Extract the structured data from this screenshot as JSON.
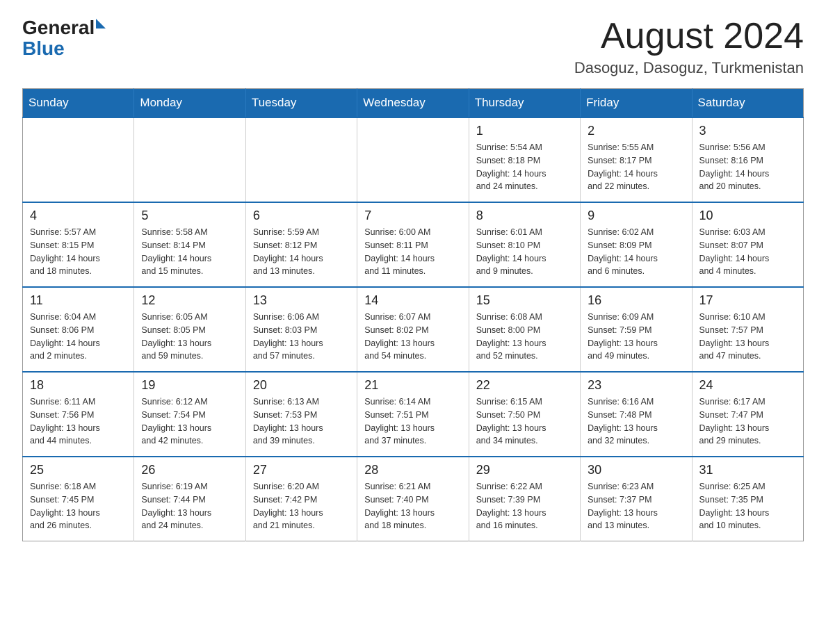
{
  "logo": {
    "general": "General",
    "triangle": "",
    "blue": "Blue"
  },
  "title": {
    "month": "August 2024",
    "location": "Dasoguz, Dasoguz, Turkmenistan"
  },
  "weekdays": [
    "Sunday",
    "Monday",
    "Tuesday",
    "Wednesday",
    "Thursday",
    "Friday",
    "Saturday"
  ],
  "weeks": [
    [
      {
        "day": "",
        "info": ""
      },
      {
        "day": "",
        "info": ""
      },
      {
        "day": "",
        "info": ""
      },
      {
        "day": "",
        "info": ""
      },
      {
        "day": "1",
        "info": "Sunrise: 5:54 AM\nSunset: 8:18 PM\nDaylight: 14 hours\nand 24 minutes."
      },
      {
        "day": "2",
        "info": "Sunrise: 5:55 AM\nSunset: 8:17 PM\nDaylight: 14 hours\nand 22 minutes."
      },
      {
        "day": "3",
        "info": "Sunrise: 5:56 AM\nSunset: 8:16 PM\nDaylight: 14 hours\nand 20 minutes."
      }
    ],
    [
      {
        "day": "4",
        "info": "Sunrise: 5:57 AM\nSunset: 8:15 PM\nDaylight: 14 hours\nand 18 minutes."
      },
      {
        "day": "5",
        "info": "Sunrise: 5:58 AM\nSunset: 8:14 PM\nDaylight: 14 hours\nand 15 minutes."
      },
      {
        "day": "6",
        "info": "Sunrise: 5:59 AM\nSunset: 8:12 PM\nDaylight: 14 hours\nand 13 minutes."
      },
      {
        "day": "7",
        "info": "Sunrise: 6:00 AM\nSunset: 8:11 PM\nDaylight: 14 hours\nand 11 minutes."
      },
      {
        "day": "8",
        "info": "Sunrise: 6:01 AM\nSunset: 8:10 PM\nDaylight: 14 hours\nand 9 minutes."
      },
      {
        "day": "9",
        "info": "Sunrise: 6:02 AM\nSunset: 8:09 PM\nDaylight: 14 hours\nand 6 minutes."
      },
      {
        "day": "10",
        "info": "Sunrise: 6:03 AM\nSunset: 8:07 PM\nDaylight: 14 hours\nand 4 minutes."
      }
    ],
    [
      {
        "day": "11",
        "info": "Sunrise: 6:04 AM\nSunset: 8:06 PM\nDaylight: 14 hours\nand 2 minutes."
      },
      {
        "day": "12",
        "info": "Sunrise: 6:05 AM\nSunset: 8:05 PM\nDaylight: 13 hours\nand 59 minutes."
      },
      {
        "day": "13",
        "info": "Sunrise: 6:06 AM\nSunset: 8:03 PM\nDaylight: 13 hours\nand 57 minutes."
      },
      {
        "day": "14",
        "info": "Sunrise: 6:07 AM\nSunset: 8:02 PM\nDaylight: 13 hours\nand 54 minutes."
      },
      {
        "day": "15",
        "info": "Sunrise: 6:08 AM\nSunset: 8:00 PM\nDaylight: 13 hours\nand 52 minutes."
      },
      {
        "day": "16",
        "info": "Sunrise: 6:09 AM\nSunset: 7:59 PM\nDaylight: 13 hours\nand 49 minutes."
      },
      {
        "day": "17",
        "info": "Sunrise: 6:10 AM\nSunset: 7:57 PM\nDaylight: 13 hours\nand 47 minutes."
      }
    ],
    [
      {
        "day": "18",
        "info": "Sunrise: 6:11 AM\nSunset: 7:56 PM\nDaylight: 13 hours\nand 44 minutes."
      },
      {
        "day": "19",
        "info": "Sunrise: 6:12 AM\nSunset: 7:54 PM\nDaylight: 13 hours\nand 42 minutes."
      },
      {
        "day": "20",
        "info": "Sunrise: 6:13 AM\nSunset: 7:53 PM\nDaylight: 13 hours\nand 39 minutes."
      },
      {
        "day": "21",
        "info": "Sunrise: 6:14 AM\nSunset: 7:51 PM\nDaylight: 13 hours\nand 37 minutes."
      },
      {
        "day": "22",
        "info": "Sunrise: 6:15 AM\nSunset: 7:50 PM\nDaylight: 13 hours\nand 34 minutes."
      },
      {
        "day": "23",
        "info": "Sunrise: 6:16 AM\nSunset: 7:48 PM\nDaylight: 13 hours\nand 32 minutes."
      },
      {
        "day": "24",
        "info": "Sunrise: 6:17 AM\nSunset: 7:47 PM\nDaylight: 13 hours\nand 29 minutes."
      }
    ],
    [
      {
        "day": "25",
        "info": "Sunrise: 6:18 AM\nSunset: 7:45 PM\nDaylight: 13 hours\nand 26 minutes."
      },
      {
        "day": "26",
        "info": "Sunrise: 6:19 AM\nSunset: 7:44 PM\nDaylight: 13 hours\nand 24 minutes."
      },
      {
        "day": "27",
        "info": "Sunrise: 6:20 AM\nSunset: 7:42 PM\nDaylight: 13 hours\nand 21 minutes."
      },
      {
        "day": "28",
        "info": "Sunrise: 6:21 AM\nSunset: 7:40 PM\nDaylight: 13 hours\nand 18 minutes."
      },
      {
        "day": "29",
        "info": "Sunrise: 6:22 AM\nSunset: 7:39 PM\nDaylight: 13 hours\nand 16 minutes."
      },
      {
        "day": "30",
        "info": "Sunrise: 6:23 AM\nSunset: 7:37 PM\nDaylight: 13 hours\nand 13 minutes."
      },
      {
        "day": "31",
        "info": "Sunrise: 6:25 AM\nSunset: 7:35 PM\nDaylight: 13 hours\nand 10 minutes."
      }
    ]
  ]
}
